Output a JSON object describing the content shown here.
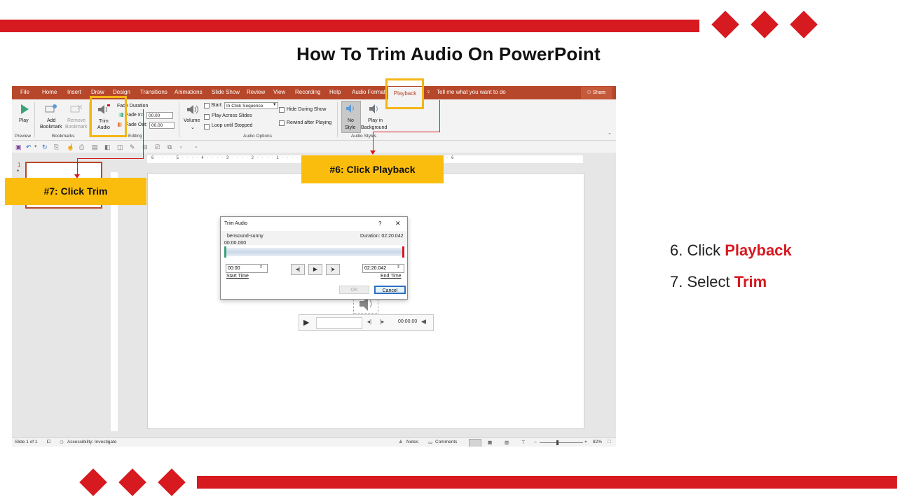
{
  "title": "How To Trim Audio On PowerPoint",
  "ribbon": {
    "tabs": [
      "File",
      "Home",
      "Insert",
      "Draw",
      "Design",
      "Transitions",
      "Animations",
      "Slide Show",
      "Review",
      "View",
      "Recording",
      "Help",
      "Audio Format"
    ],
    "active_tab": "Playback",
    "tell_me": "Tell me what you want to do",
    "share": "Share",
    "play": "Play",
    "add_bookmark_1": "Add",
    "add_bookmark_2": "Bookmark",
    "remove_bookmark_1": "Remove",
    "remove_bookmark_2": "Bookmark",
    "trim_1": "Trim",
    "trim_2": "Audio",
    "fade_duration": "Fade Duration",
    "fade_in": "Fade In:",
    "fade_in_value": "00.00",
    "fade_out": "Fade Out:",
    "fade_out_value": "00.00",
    "volume": "Volume",
    "start_label": "Start:",
    "start_value": "In Click Sequence",
    "play_across": "Play Across Slides",
    "loop": "Loop until Stopped",
    "hide_during": "Hide During Show",
    "rewind": "Rewind after Playing",
    "no_style_1": "No",
    "no_style_2": "Style",
    "play_bg_1": "Play in",
    "play_bg_2": "Background",
    "groups": {
      "preview": "Preview",
      "bookmarks": "Bookmarks",
      "editing": "Editing",
      "audio_options": "Audio Options",
      "audio_styles": "Audio Styles"
    }
  },
  "ruler": {
    "ticks": "6 · · · · 5 · · · · 4 · · · · 3 · · · · 2 · · · · 1 · · · · 0 · · · · 1 · · · · 2 · · · · 3 · · · · 4 · · · · 5 · · · · 6"
  },
  "thumbs": {
    "number": "1",
    "star": "*"
  },
  "dialog": {
    "title": "Trim Audio",
    "help": "?",
    "close": "✕",
    "file": "bensound-sunny",
    "duration": "Duration: 02:20.042",
    "position": "00:00.000",
    "start_time_value": "00:00",
    "end_time_value": "02:20.042",
    "start_time_label": "Start Time",
    "end_time_label": "End Time",
    "ok": "OK",
    "cancel": "Cancel"
  },
  "player": {
    "time": "00:00.00"
  },
  "status": {
    "slide": "Slide 1 of 1",
    "accessibility": "Accessibility: Investigate",
    "notes": "Notes",
    "comments": "Comments",
    "zoom": "82%"
  },
  "callouts": {
    "playback": "#6: Click Playback",
    "trim": "#7: Click Trim"
  },
  "steps": [
    {
      "prefix": "6. Click ",
      "action": "Playback"
    },
    {
      "prefix": "7. Select ",
      "action": "Trim"
    }
  ],
  "colors": {
    "accent": "#d71920",
    "callout": "#fbbd0d",
    "ribbon": "#b7472a"
  }
}
